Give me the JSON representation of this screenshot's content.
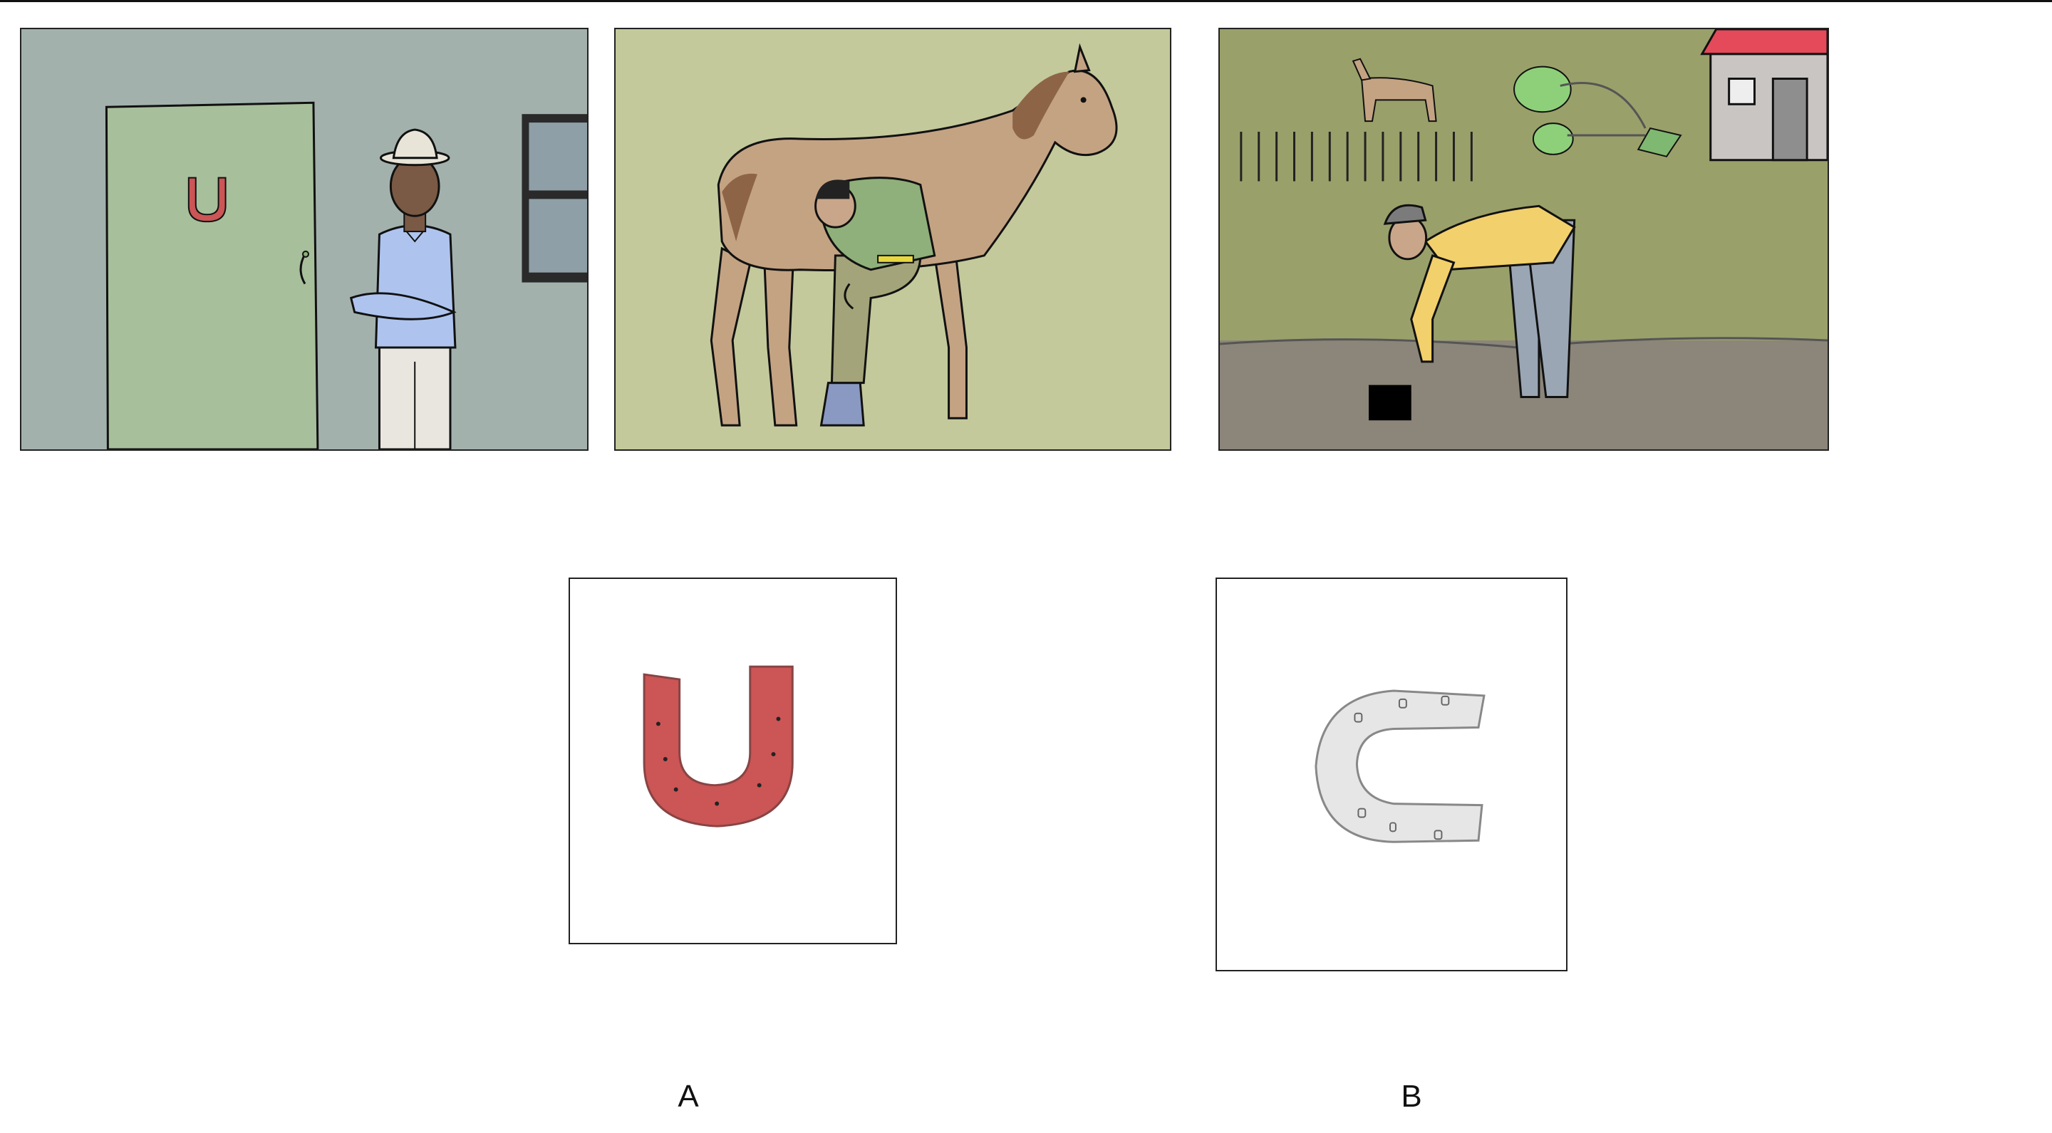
{
  "panels": [
    {
      "id": "panel-1",
      "scene": "man-at-door-with-horseshoe"
    },
    {
      "id": "panel-2",
      "scene": "farrier-shoeing-horse"
    },
    {
      "id": "panel-3",
      "scene": "man-picking-up-object-in-field"
    }
  ],
  "options": [
    {
      "label": "A",
      "icon": "red-horseshoe-icon",
      "color": "#cc5555"
    },
    {
      "label": "B",
      "icon": "gray-horseshoe-icon",
      "color": "#e6e6e6"
    }
  ],
  "colors": {
    "wall": "#a3b1ad",
    "door": "#a7bf9b",
    "stable_bg": "#c3c99b",
    "horse": "#c4a383",
    "grass": "#9aa06a",
    "road": "#8b857a",
    "roof": "#e44a5a"
  }
}
